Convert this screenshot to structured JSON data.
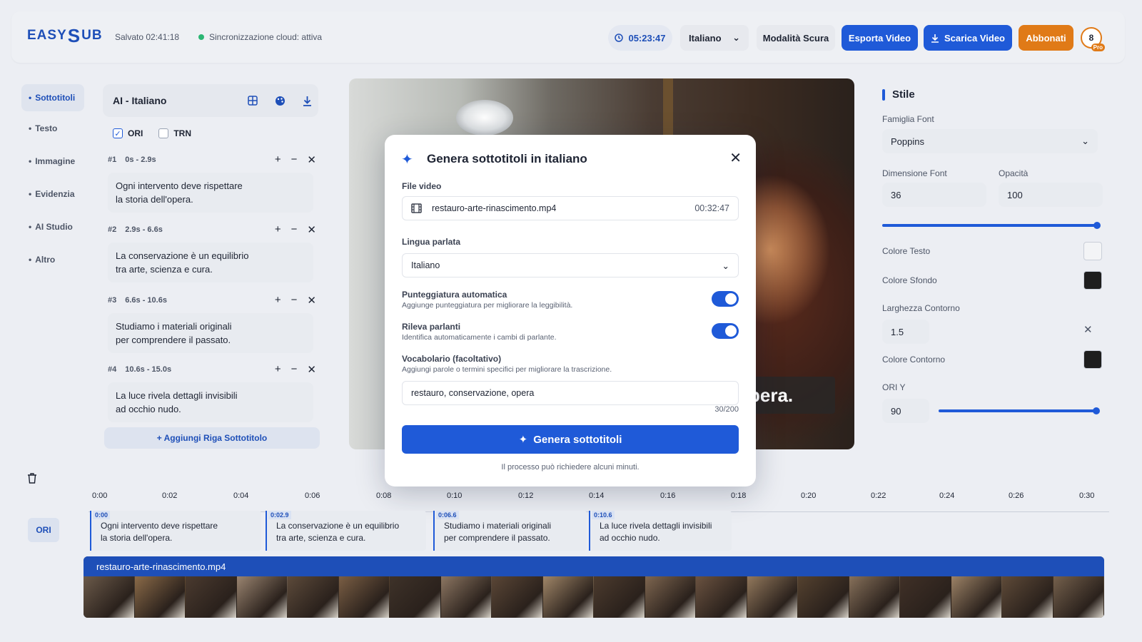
{
  "header": {
    "logo": "EASY",
    "logo_s": "S",
    "logo_tail": "UB",
    "saved": "Salvato 02:41:18",
    "sync": "Sincronizzazione cloud: attiva",
    "timer": "05:23:47",
    "language": "Italiano",
    "dark_mode": "Modalità Scura",
    "export": "Esporta Video",
    "download": "Scarica Video",
    "subscribe": "Abbonati",
    "avatar": "8",
    "pro_badge": "Pro"
  },
  "nav": {
    "items": [
      "Sottotitoli",
      "Testo",
      "Immagine",
      "Evidenzia",
      "AI Studio",
      "Altro"
    ],
    "active": "Sottotitoli"
  },
  "subtitles": {
    "title": "AI - Italiano",
    "check_ori": "ORI",
    "check_trn": "TRN",
    "segments": [
      {
        "id": "#1",
        "time": "0s - 2.9s",
        "line1": "Ogni intervento deve rispettare",
        "line2": "la storia dell'opera."
      },
      {
        "id": "#2",
        "time": "2.9s - 6.6s",
        "line1": "La conservazione è un equilibrio",
        "line2": "tra arte, scienza e cura."
      },
      {
        "id": "#3",
        "time": "6.6s - 10.6s",
        "line1": "Studiamo i materiali originali",
        "line2": "per comprendere il passato."
      },
      {
        "id": "#4",
        "time": "10.6s - 15.0s",
        "line1": "La luce rivela dettagli invisibili",
        "line2": "ad occhio nudo."
      }
    ],
    "add_row": "+ Aggiungi Riga Sottotitolo"
  },
  "video": {
    "caption": "pera."
  },
  "style": {
    "title": "Stile",
    "font_family_label": "Famiglia Font",
    "font_family": "Poppins",
    "font_size_label": "Dimensione Font",
    "font_size": "36",
    "opacity_label": "Opacità",
    "opacity": "100",
    "text_color_label": "Colore Testo",
    "bg_color_label": "Colore Sfondo",
    "outline_width_label": "Larghezza Contorno",
    "outline_width": "1.5",
    "outline_color_label": "Colore Contorno",
    "ori_y_label": "ORI Y",
    "ori_y": "90",
    "text_color": "#f3f4f6",
    "bg_color": "#1e1e1e",
    "outline_color": "#1e1e1e"
  },
  "modal": {
    "title": "Genera sottotitoli in italiano",
    "file_label": "File video",
    "file_name": "restauro-arte-rinascimento.mp4",
    "file_duration": "00:32:47",
    "lang_label": "Lingua parlata",
    "lang_value": "Italiano",
    "punct_title": "Punteggiatura automatica",
    "punct_desc": "Aggiunge punteggiatura per migliorare la leggibilità.",
    "speakers_title": "Rileva parlanti",
    "speakers_desc": "Identifica automaticamente i cambi di parlante.",
    "vocab_title": "Vocabolario (facoltativo)",
    "vocab_desc": "Aggiungi parole o termini specifici per migliorare la trascrizione.",
    "vocab_value": "restauro, conservazione, opera",
    "vocab_count": "30/200",
    "generate": "Genera sottotitoli",
    "note": "Il processo può richiedere alcuni minuti."
  },
  "timeline": {
    "ticks": [
      "0:00",
      "0:02",
      "0:04",
      "0:06",
      "0:08",
      "0:10",
      "0:12",
      "0:14",
      "0:16",
      "0:18",
      "0:20",
      "0:22",
      "0:24",
      "0:26",
      "0:30"
    ],
    "track_label": "ORI",
    "clips": [
      {
        "start": "0:00",
        "line1": "Ogni intervento deve rispettare",
        "line2": "la storia dell'opera."
      },
      {
        "start": "0:02.9",
        "line1": "La conservazione è un equilibrio",
        "line2": "tra arte, scienza e cura."
      },
      {
        "start": "0:06.6",
        "line1": "Studiamo i materiali originali",
        "line2": "per comprendere il passato."
      },
      {
        "start": "0:10.6",
        "line1": "La luce rivela dettagli invisibili",
        "line2": "ad occhio nudo."
      }
    ],
    "video_track": "restauro-arte-rinascimento.mp4"
  },
  "colors": {
    "accent": "#1f5ad8",
    "subscribe": "#e07a17",
    "sync_dot": "#2bb673"
  }
}
